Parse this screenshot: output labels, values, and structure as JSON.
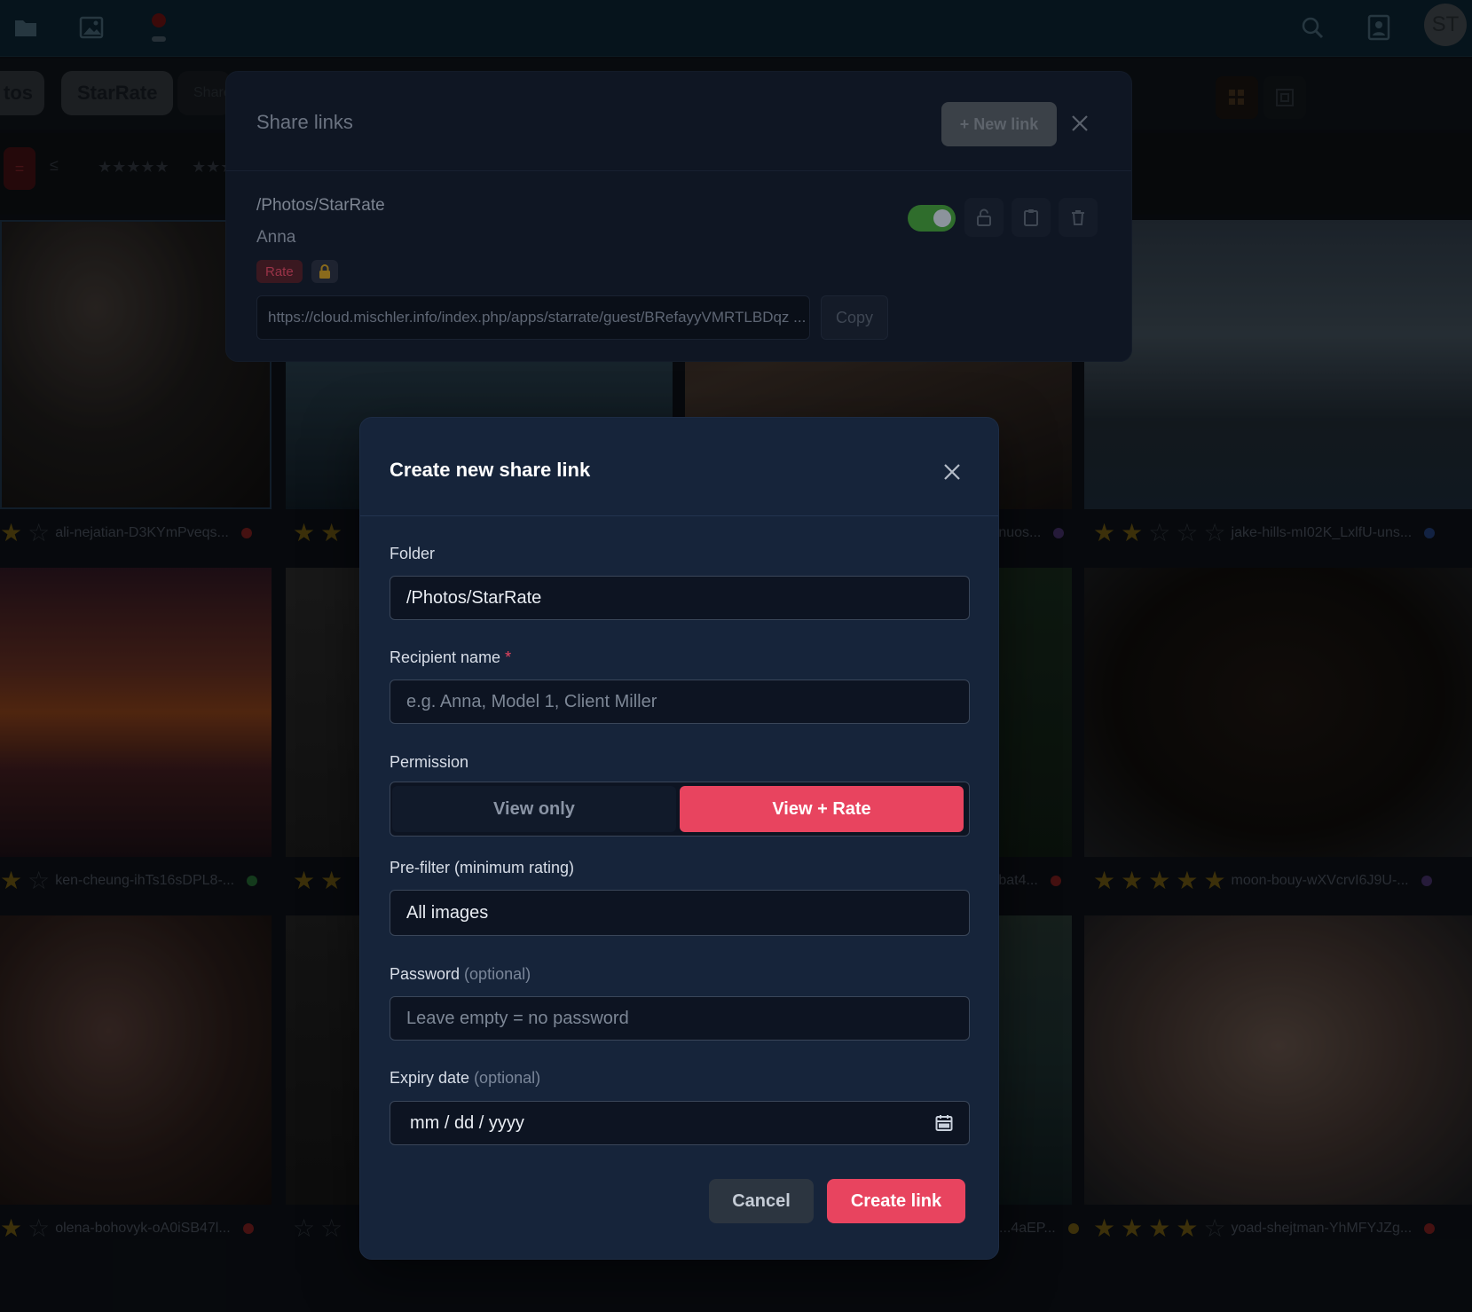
{
  "topbar": {
    "icons": [
      "folder-icon",
      "image-icon",
      "record-icon",
      "search-icon",
      "contacts-icon"
    ],
    "avatar_initials": "ST"
  },
  "background": {
    "breadcrumb": [
      "tos",
      "StarRate",
      "Share"
    ],
    "filter_chips": [
      "=",
      "≤",
      "★★★★★",
      "★★★"
    ],
    "captions": [
      {
        "name": "ali-nejatian-D3KYmPveqs...",
        "stars": 1,
        "color": "#6b1b1b"
      },
      {
        "name": "...nuos...",
        "stars": 2,
        "color": "#3b2a5a"
      },
      {
        "name": "jake-hills-mI02K_LxlfU-uns...",
        "stars": 2,
        "color": "#1d3566"
      },
      {
        "name": "ken-cheung-ihTs16sDPL8-...",
        "stars": 1,
        "color": "#1f5a2b"
      },
      {
        "name": "...bat4...",
        "stars": 2,
        "color": "#6b1b1b"
      },
      {
        "name": "moon-bouy-wXVcrvI6J9U-...",
        "stars": 5,
        "color": "#3b2a5a"
      },
      {
        "name": "olena-bohovyk-oA0iSB47l...",
        "stars": 1,
        "color": "#6b1b1b"
      },
      {
        "name": "...4aEP...",
        "stars": 0,
        "color": "#5c4b10"
      },
      {
        "name": "yoad-shejtman-YhMFYJZg...",
        "stars": 4,
        "color": "#6b1b1b"
      }
    ]
  },
  "share_panel": {
    "title": "Share links",
    "new_link_label": "+ New link",
    "link": {
      "folder": "/Photos/StarRate",
      "recipient": "Anna",
      "permission_badge": "Rate",
      "enabled": true,
      "url": "https://cloud.mischler.info/index.php/apps/starrate/guest/BRefayyVMRTLBDqz ...",
      "copy_label": "Copy"
    }
  },
  "modal": {
    "title": "Create new share link",
    "folder": {
      "label": "Folder",
      "value": "/Photos/StarRate"
    },
    "recipient": {
      "label": "Recipient name",
      "required_mark": "*",
      "placeholder": "e.g. Anna, Model 1, Client Miller"
    },
    "permission": {
      "label": "Permission",
      "options": [
        "View only",
        "View + Rate"
      ],
      "selected": "View + Rate"
    },
    "prefilter": {
      "label": "Pre-filter (minimum rating)",
      "value": "All images"
    },
    "password": {
      "label": "Password",
      "optional": "(optional)",
      "placeholder": "Leave empty = no password"
    },
    "expiry": {
      "label": "Expiry date",
      "optional": "(optional)",
      "placeholder": "mm / dd / yyyy"
    },
    "cancel_label": "Cancel",
    "create_label": "Create link"
  },
  "colors": {
    "accent": "#e8445f",
    "modal_bg": "#16243a",
    "input_bg": "#0d1422",
    "toggle_on": "#2f6d2c"
  }
}
